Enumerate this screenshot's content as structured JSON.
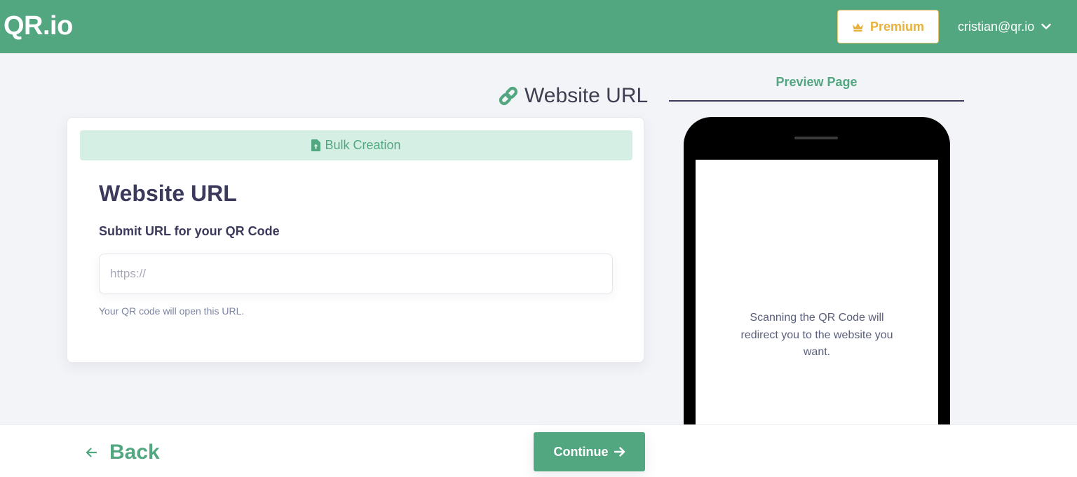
{
  "header": {
    "logo": "QR.io",
    "premium_label": "Premium",
    "user_email": "cristian@qr.io"
  },
  "page": {
    "section_title": "Website URL",
    "preview_tab": "Preview Page"
  },
  "form": {
    "bulk_label": "Bulk Creation",
    "title": "Website URL",
    "field_label": "Submit URL for your QR Code",
    "url_placeholder": "https://",
    "url_value": "",
    "help_text": "Your QR code will open this URL."
  },
  "preview": {
    "message": "Scanning the QR Code will redirect you to the website you want."
  },
  "footer": {
    "back_label": "Back",
    "continue_label": "Continue"
  },
  "colors": {
    "brand_green": "#52a781",
    "premium_gold": "#e6b23b",
    "bulk_bg": "#d6efe5",
    "text_dark": "#3b3a5c"
  },
  "icons": [
    "crown-icon",
    "chevron-down-icon",
    "link-icon",
    "file-upload-icon",
    "arrow-left-icon",
    "arrow-right-icon"
  ]
}
